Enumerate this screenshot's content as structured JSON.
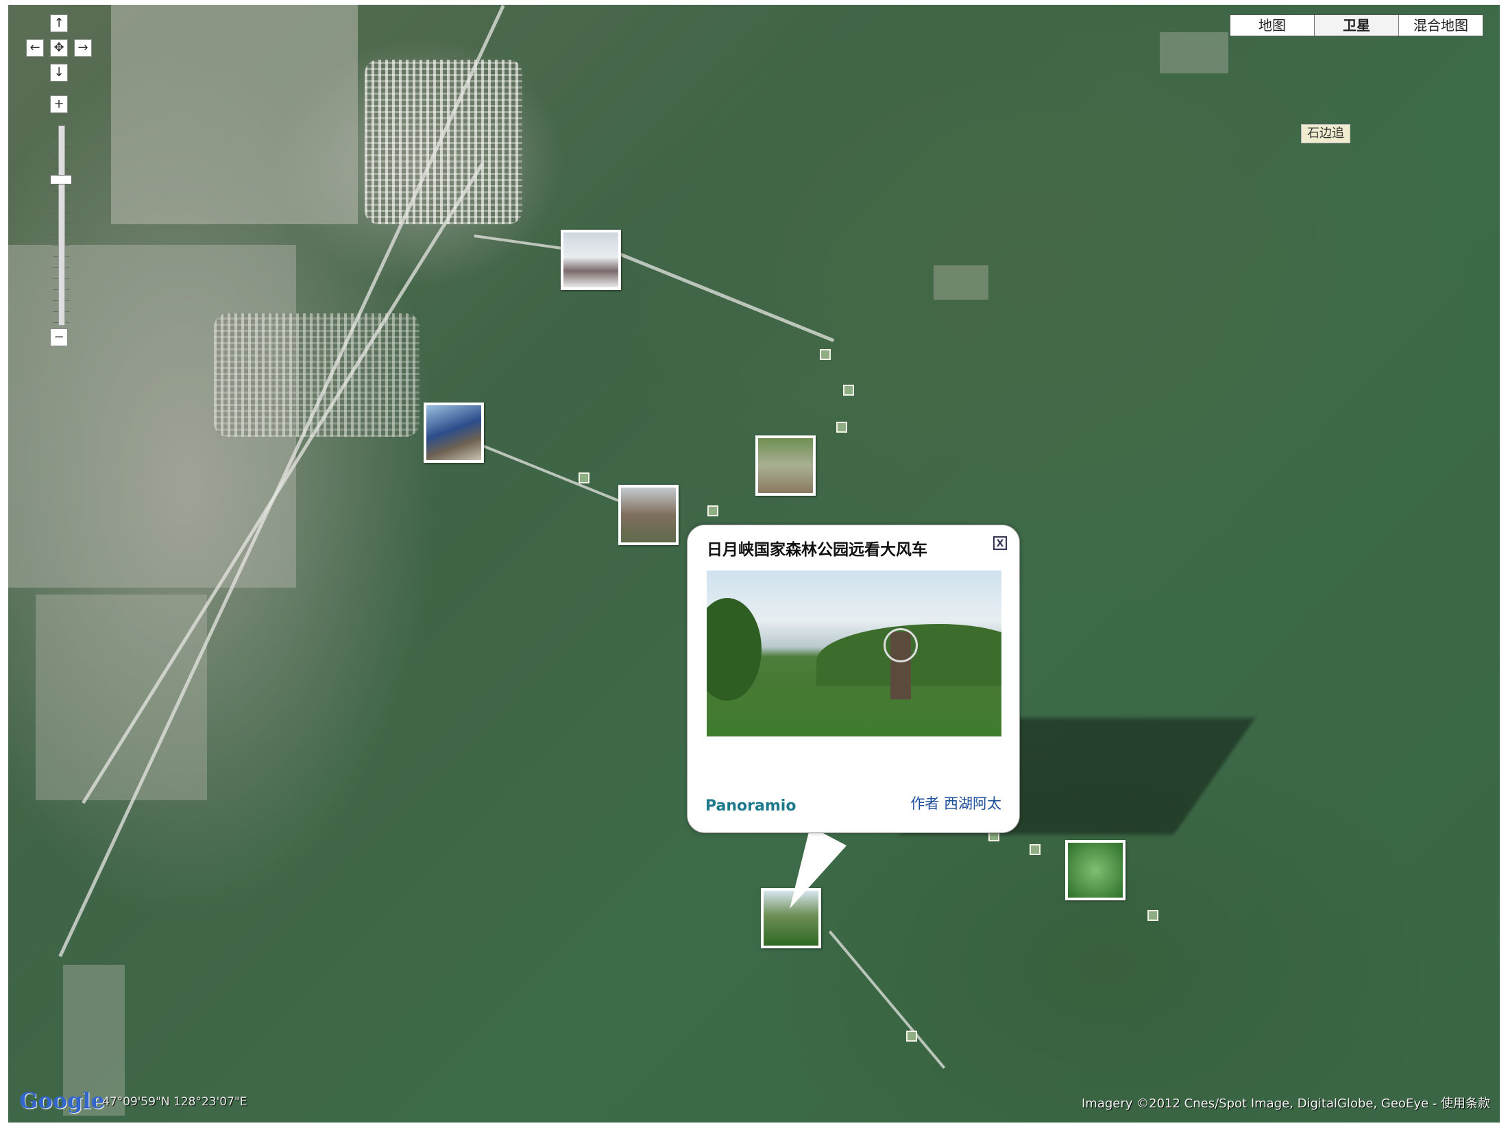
{
  "navigation": {
    "pan_up": "↑",
    "pan_left": "←",
    "pan_center": "✥",
    "pan_right": "→",
    "pan_down": "↓",
    "zoom_in": "+",
    "zoom_out": "−"
  },
  "map_type": {
    "options": [
      "地图",
      "卫星",
      "混合地图"
    ],
    "selected": "卫星"
  },
  "place_label": "石边追",
  "popup": {
    "title": "日月峡国家森林公园远看大风车",
    "close_label": "X",
    "brand": "Panoramio",
    "author": "作者 西湖阿太"
  },
  "footer": {
    "logo": "Google",
    "coordinates": "47°09'59\"N 128°23'07\"E",
    "attribution": "Imagery ©2012 Cnes/Spot Image, DigitalGlobe, GeoEye - 使用条款"
  },
  "icons": {
    "photo_marker": "photo-thumbnail-icon",
    "small_marker": "photo-marker-icon",
    "close": "close-icon"
  }
}
